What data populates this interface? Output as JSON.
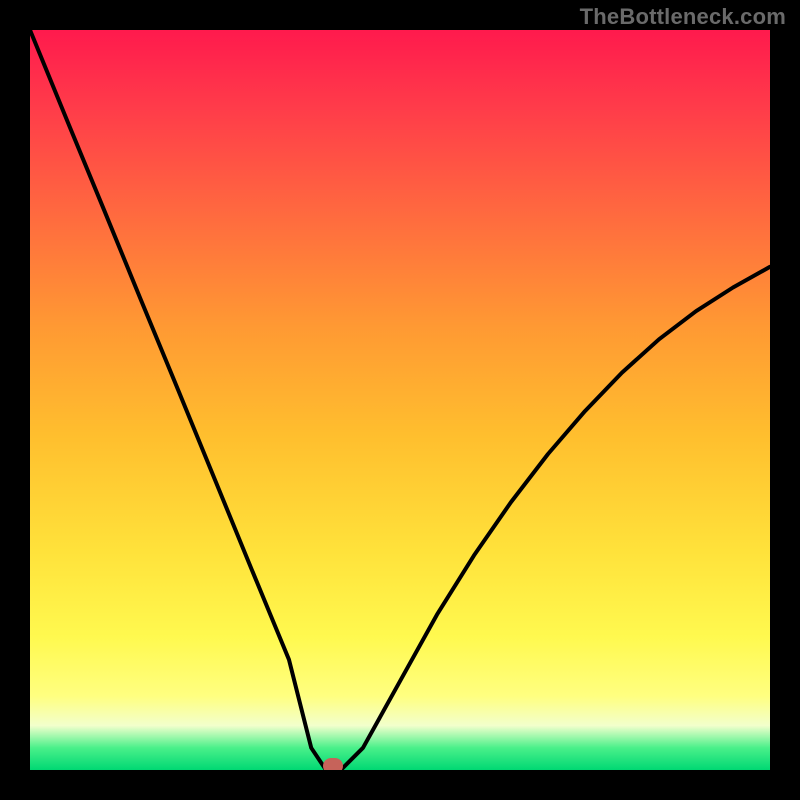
{
  "watermark": "TheBottleneck.com",
  "chart_data": {
    "type": "line",
    "title": "",
    "xlabel": "",
    "ylabel": "",
    "xlim": [
      0,
      1
    ],
    "ylim": [
      0,
      1
    ],
    "x": [
      0.0,
      0.05,
      0.1,
      0.15,
      0.2,
      0.25,
      0.3,
      0.35,
      0.38,
      0.4,
      0.42,
      0.45,
      0.5,
      0.55,
      0.6,
      0.65,
      0.7,
      0.75,
      0.8,
      0.85,
      0.9,
      0.95,
      1.0
    ],
    "y": [
      1.0,
      0.878,
      0.757,
      0.635,
      0.514,
      0.392,
      0.27,
      0.149,
      0.03,
      0.0,
      0.0,
      0.03,
      0.12,
      0.21,
      0.29,
      0.362,
      0.427,
      0.485,
      0.537,
      0.582,
      0.62,
      0.652,
      0.68
    ],
    "background_gradient_stops": [
      {
        "offset": 0.0,
        "color": "#ff1a4d"
      },
      {
        "offset": 0.1,
        "color": "#ff3a4a"
      },
      {
        "offset": 0.25,
        "color": "#ff6a3f"
      },
      {
        "offset": 0.4,
        "color": "#ff9933"
      },
      {
        "offset": 0.55,
        "color": "#ffbf2e"
      },
      {
        "offset": 0.7,
        "color": "#ffe13a"
      },
      {
        "offset": 0.82,
        "color": "#fff94f"
      },
      {
        "offset": 0.9,
        "color": "#ffff80"
      },
      {
        "offset": 0.94,
        "color": "#f2ffcc"
      },
      {
        "offset": 0.97,
        "color": "#4af08a"
      },
      {
        "offset": 1.0,
        "color": "#00d873"
      }
    ],
    "marker": {
      "x": 0.41,
      "y": 0.0,
      "color": "#c6635a"
    }
  }
}
